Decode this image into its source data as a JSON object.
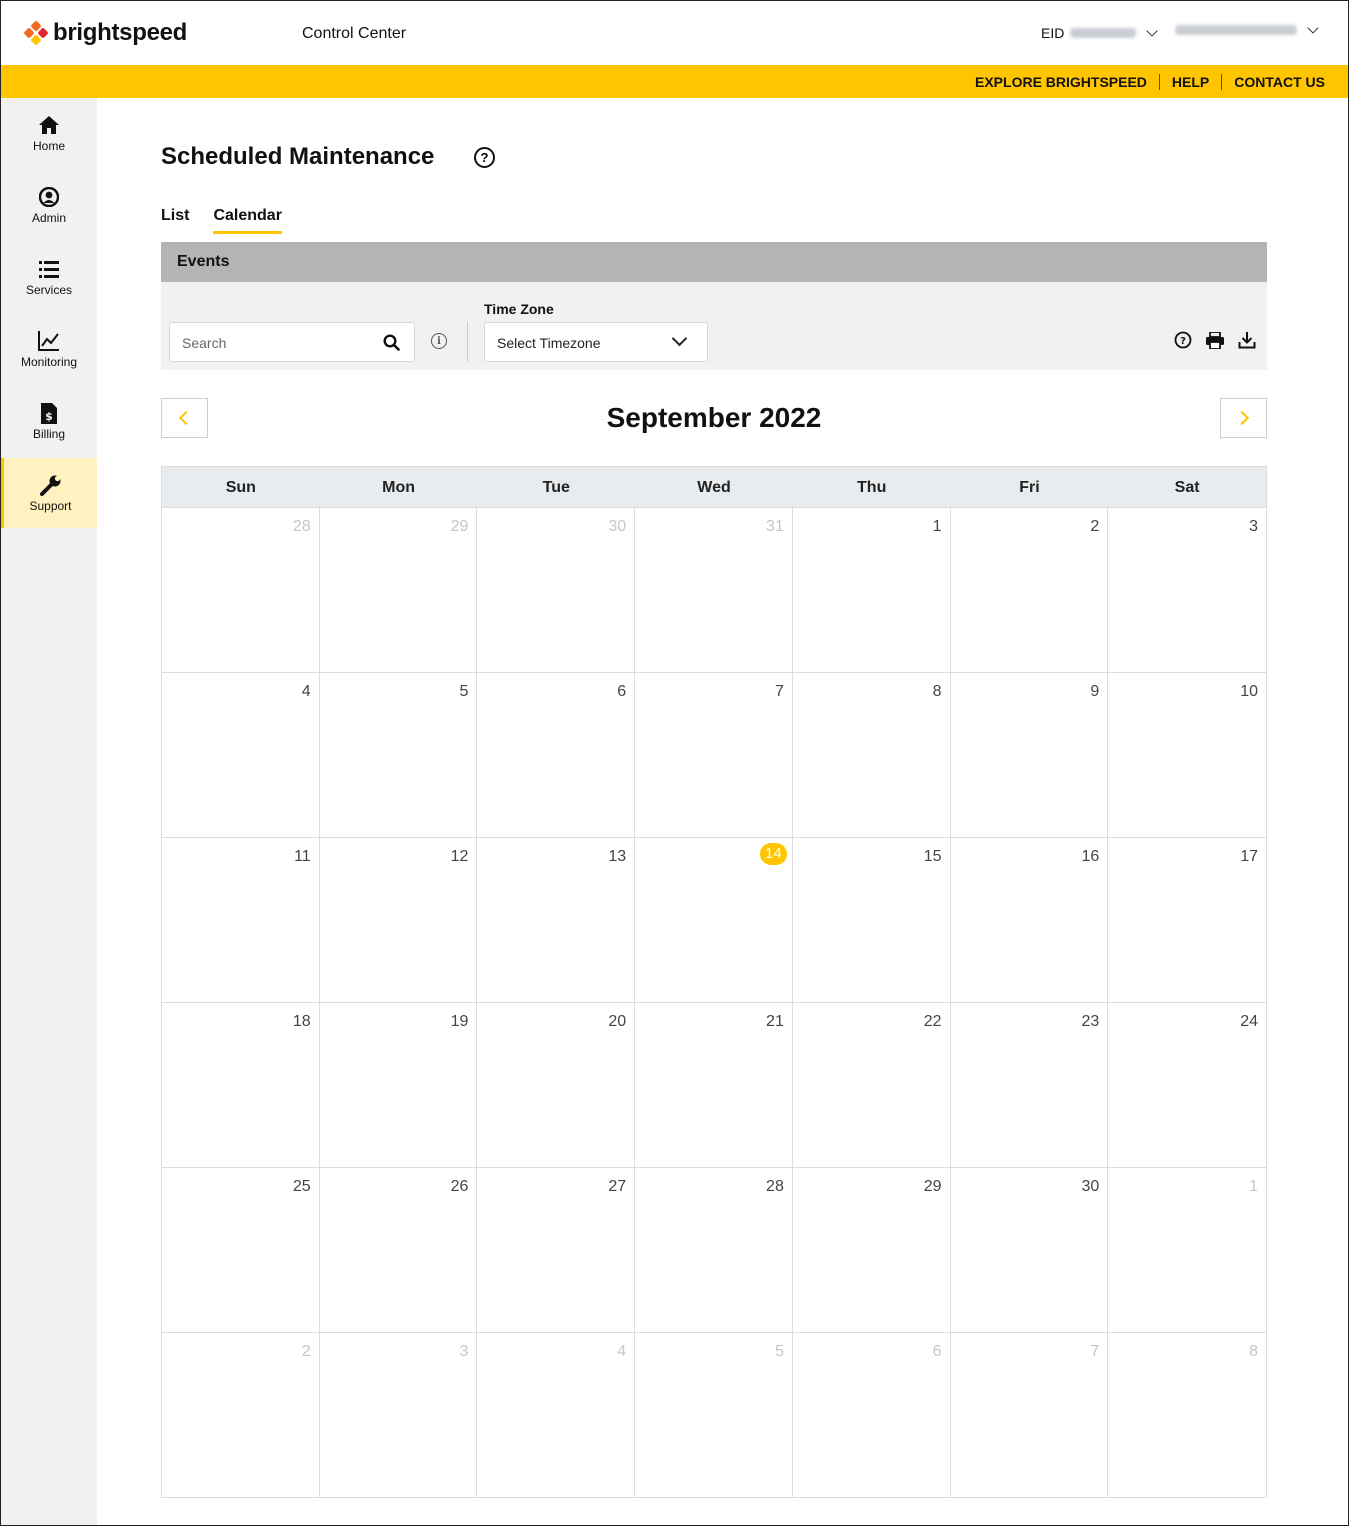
{
  "header": {
    "brand": "brightspeed",
    "app_title": "Control Center",
    "eid_label": "EID",
    "brand_colors": {
      "orange": "#f26b21",
      "red": "#e4262c",
      "yellow": "#ffc500"
    }
  },
  "utility_nav": [
    "EXPLORE BRIGHTSPEED",
    "HELP",
    "CONTACT US"
  ],
  "sidebar": {
    "items": [
      {
        "label": "Home",
        "icon": "home-icon"
      },
      {
        "label": "Admin",
        "icon": "user-circle-icon"
      },
      {
        "label": "Services",
        "icon": "list-icon"
      },
      {
        "label": "Monitoring",
        "icon": "chart-line-icon"
      },
      {
        "label": "Billing",
        "icon": "invoice-dollar-icon"
      },
      {
        "label": "Support",
        "icon": "wrench-icon",
        "active": true
      }
    ]
  },
  "page": {
    "title": "Scheduled Maintenance",
    "tabs": [
      {
        "label": "List",
        "active": false
      },
      {
        "label": "Calendar",
        "active": true
      }
    ]
  },
  "events": {
    "section_title": "Events",
    "search_placeholder": "Search",
    "timezone_label": "Time Zone",
    "timezone_value": "Select Timezone",
    "toolbar_icons": [
      "help-icon",
      "print-icon",
      "download-icon"
    ]
  },
  "calendar": {
    "month_title": "September 2022",
    "weekdays": [
      "Sun",
      "Mon",
      "Tue",
      "Wed",
      "Thu",
      "Fri",
      "Sat"
    ],
    "today": "14",
    "days": [
      {
        "d": "28",
        "muted": true
      },
      {
        "d": "29",
        "muted": true
      },
      {
        "d": "30",
        "muted": true
      },
      {
        "d": "31",
        "muted": true
      },
      {
        "d": "1"
      },
      {
        "d": "2"
      },
      {
        "d": "3"
      },
      {
        "d": "4"
      },
      {
        "d": "5"
      },
      {
        "d": "6"
      },
      {
        "d": "7"
      },
      {
        "d": "8"
      },
      {
        "d": "9"
      },
      {
        "d": "10"
      },
      {
        "d": "11"
      },
      {
        "d": "12"
      },
      {
        "d": "13"
      },
      {
        "d": "14",
        "today": true
      },
      {
        "d": "15"
      },
      {
        "d": "16"
      },
      {
        "d": "17"
      },
      {
        "d": "18"
      },
      {
        "d": "19"
      },
      {
        "d": "20"
      },
      {
        "d": "21"
      },
      {
        "d": "22"
      },
      {
        "d": "23"
      },
      {
        "d": "24"
      },
      {
        "d": "25"
      },
      {
        "d": "26"
      },
      {
        "d": "27"
      },
      {
        "d": "28"
      },
      {
        "d": "29"
      },
      {
        "d": "30"
      },
      {
        "d": "1",
        "muted": true
      },
      {
        "d": "2",
        "muted": true
      },
      {
        "d": "3",
        "muted": true
      },
      {
        "d": "4",
        "muted": true
      },
      {
        "d": "5",
        "muted": true
      },
      {
        "d": "6",
        "muted": true
      },
      {
        "d": "7",
        "muted": true
      },
      {
        "d": "8",
        "muted": true
      }
    ]
  }
}
